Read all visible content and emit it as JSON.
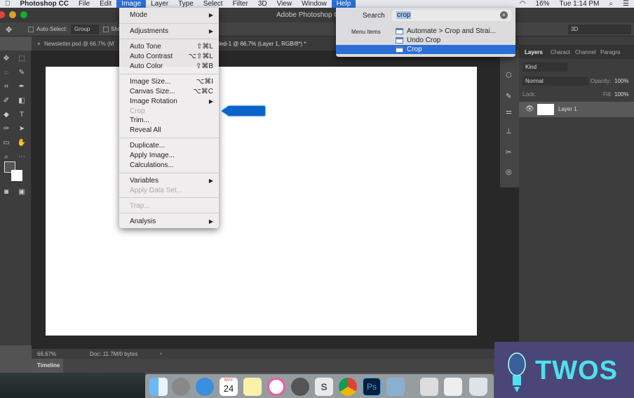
{
  "menubar": {
    "apple": "",
    "app": "Photoshop CC",
    "items": [
      "File",
      "Edit",
      "Image",
      "Layer",
      "Type",
      "Select",
      "Filter",
      "3D",
      "View",
      "Window",
      "Help"
    ],
    "battery": "16%",
    "clock": "Tue 1:14 PM"
  },
  "window": {
    "title": "Adobe Photoshop C"
  },
  "options": {
    "auto_select": "Auto-Select:",
    "group": "Group",
    "show": "Sho",
    "workspace": "3D"
  },
  "tabs": [
    {
      "label": "Newsletter.psd @ 66.7% (M"
    },
    {
      "label": "tled-1 @ 66.7% (Layer 1, RGB/8*) *"
    }
  ],
  "image_menu": {
    "items": [
      {
        "label": "Mode",
        "submenu": true
      },
      {
        "label": "Adjustments",
        "submenu": true
      },
      {
        "label": "Auto Tone",
        "shortcut": "⇧⌘L"
      },
      {
        "label": "Auto Contrast",
        "shortcut": "⌥⇧⌘L"
      },
      {
        "label": "Auto Color",
        "shortcut": "⇧⌘B"
      },
      {
        "label": "Image Size...",
        "shortcut": "⌥⌘I"
      },
      {
        "label": "Canvas Size...",
        "shortcut": "⌥⌘C"
      },
      {
        "label": "Image Rotation",
        "submenu": true
      },
      {
        "label": "Crop",
        "disabled": true
      },
      {
        "label": "Trim..."
      },
      {
        "label": "Reveal All"
      },
      {
        "label": "Duplicate..."
      },
      {
        "label": "Apply Image..."
      },
      {
        "label": "Calculations..."
      },
      {
        "label": "Variables",
        "submenu": true
      },
      {
        "label": "Apply Data Set...",
        "disabled": true
      },
      {
        "label": "Trap...",
        "disabled": true
      },
      {
        "label": "Analysis",
        "submenu": true
      }
    ]
  },
  "help_search": {
    "label": "Search",
    "query": "crop",
    "section": "Menu Items",
    "results": [
      "Automate > Crop and Strai...",
      "Undo Crop",
      "Crop"
    ],
    "selected": 2
  },
  "layers_panel": {
    "tabs": [
      "Layers",
      "Charact",
      "Channel",
      "Paragra"
    ],
    "kind": "Kind",
    "blend": "Normal",
    "opacity_label": "Opacity:",
    "opacity": "100%",
    "lock_label": "Lock:",
    "fill_label": "Fill:",
    "fill": "100%",
    "layer": "Layer 1"
  },
  "status": {
    "zoom": "66.67%",
    "doc": "Doc: 11.7M/0 bytes",
    "arrow": "›"
  },
  "timeline": {
    "label": "Timeline"
  },
  "dock": {
    "calendar_month": "MAY",
    "calendar_day": "24",
    "ps": "Ps",
    "slack": "S"
  },
  "logo": {
    "text": "TWOS"
  },
  "colors": {
    "accent": "#2b6fd6",
    "pointer": "#0a63c9",
    "logo_text": "#4fe0ee",
    "logo_bg": "#4a4778"
  }
}
